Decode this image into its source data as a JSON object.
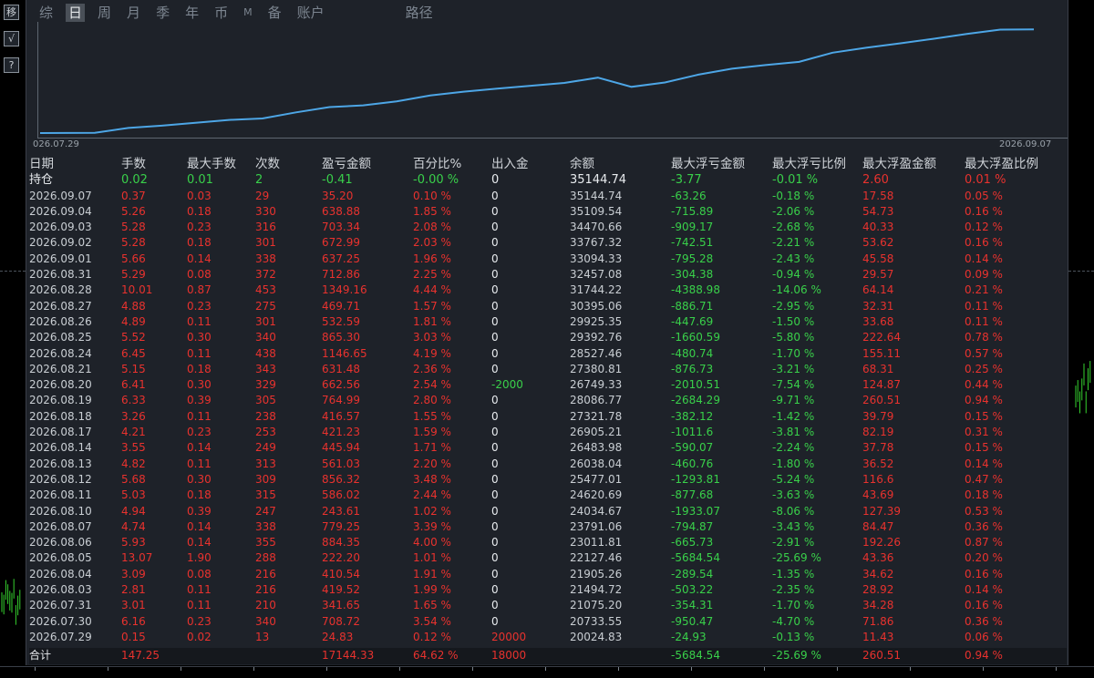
{
  "toolbar": {
    "tabs": [
      "综",
      "日",
      "周",
      "月",
      "季",
      "年",
      "币",
      "M",
      "备",
      "账户",
      "路径"
    ],
    "active_index": 1
  },
  "side_buttons": [
    "移",
    "√",
    "?"
  ],
  "equity_chart": {
    "start_label": "026.07.29",
    "end_label": "2026.09.07",
    "line_color": "#4da6e6"
  },
  "columns": [
    "日期",
    "手数",
    "最大手数",
    "次数",
    "盈亏金额",
    "百分比%",
    "出入金",
    "余额",
    "最大浮亏金额",
    "最大浮亏比例",
    "最大浮盈金额",
    "最大浮盈比例"
  ],
  "holding": [
    "持仓",
    "0.02",
    "0.01",
    "2",
    "-0.41",
    "-0.00 %",
    "0",
    "35144.74",
    "-3.77",
    "-0.01 %",
    "2.60",
    "0.01 %"
  ],
  "rows": [
    [
      "2026.09.07",
      "0.37",
      "0.03",
      "29",
      "35.20",
      "0.10 %",
      "0",
      "35144.74",
      "-63.26",
      "-0.18 %",
      "17.58",
      "0.05 %"
    ],
    [
      "2026.09.04",
      "5.26",
      "0.18",
      "330",
      "638.88",
      "1.85 %",
      "0",
      "35109.54",
      "-715.89",
      "-2.06 %",
      "54.73",
      "0.16 %"
    ],
    [
      "2026.09.03",
      "5.28",
      "0.23",
      "316",
      "703.34",
      "2.08 %",
      "0",
      "34470.66",
      "-909.17",
      "-2.68 %",
      "40.33",
      "0.12 %"
    ],
    [
      "2026.09.02",
      "5.28",
      "0.18",
      "301",
      "672.99",
      "2.03 %",
      "0",
      "33767.32",
      "-742.51",
      "-2.21 %",
      "53.62",
      "0.16 %"
    ],
    [
      "2026.09.01",
      "5.66",
      "0.14",
      "338",
      "637.25",
      "1.96 %",
      "0",
      "33094.33",
      "-795.28",
      "-2.43 %",
      "45.58",
      "0.14 %"
    ],
    [
      "2026.08.31",
      "5.29",
      "0.08",
      "372",
      "712.86",
      "2.25 %",
      "0",
      "32457.08",
      "-304.38",
      "-0.94 %",
      "29.57",
      "0.09 %"
    ],
    [
      "2026.08.28",
      "10.01",
      "0.87",
      "453",
      "1349.16",
      "4.44 %",
      "0",
      "31744.22",
      "-4388.98",
      "-14.06 %",
      "64.14",
      "0.21 %"
    ],
    [
      "2026.08.27",
      "4.88",
      "0.23",
      "275",
      "469.71",
      "1.57 %",
      "0",
      "30395.06",
      "-886.71",
      "-2.95 %",
      "32.31",
      "0.11 %"
    ],
    [
      "2026.08.26",
      "4.89",
      "0.11",
      "301",
      "532.59",
      "1.81 %",
      "0",
      "29925.35",
      "-447.69",
      "-1.50 %",
      "33.68",
      "0.11 %"
    ],
    [
      "2026.08.25",
      "5.52",
      "0.30",
      "340",
      "865.30",
      "3.03 %",
      "0",
      "29392.76",
      "-1660.59",
      "-5.80 %",
      "222.64",
      "0.78 %"
    ],
    [
      "2026.08.24",
      "6.45",
      "0.11",
      "438",
      "1146.65",
      "4.19 %",
      "0",
      "28527.46",
      "-480.74",
      "-1.70 %",
      "155.11",
      "0.57 %"
    ],
    [
      "2026.08.21",
      "5.15",
      "0.18",
      "343",
      "631.48",
      "2.36 %",
      "0",
      "27380.81",
      "-876.73",
      "-3.21 %",
      "68.31",
      "0.25 %"
    ],
    [
      "2026.08.20",
      "6.41",
      "0.30",
      "329",
      "662.56",
      "2.54 %",
      "-2000",
      "26749.33",
      "-2010.51",
      "-7.54 %",
      "124.87",
      "0.44 %"
    ],
    [
      "2026.08.19",
      "6.33",
      "0.39",
      "305",
      "764.99",
      "2.80 %",
      "0",
      "28086.77",
      "-2684.29",
      "-9.71 %",
      "260.51",
      "0.94 %"
    ],
    [
      "2026.08.18",
      "3.26",
      "0.11",
      "238",
      "416.57",
      "1.55 %",
      "0",
      "27321.78",
      "-382.12",
      "-1.42 %",
      "39.79",
      "0.15 %"
    ],
    [
      "2026.08.17",
      "4.21",
      "0.23",
      "253",
      "421.23",
      "1.59 %",
      "0",
      "26905.21",
      "-1011.6",
      "-3.81 %",
      "82.19",
      "0.31 %"
    ],
    [
      "2026.08.14",
      "3.55",
      "0.14",
      "249",
      "445.94",
      "1.71 %",
      "0",
      "26483.98",
      "-590.07",
      "-2.24 %",
      "37.78",
      "0.15 %"
    ],
    [
      "2026.08.13",
      "4.82",
      "0.11",
      "313",
      "561.03",
      "2.20 %",
      "0",
      "26038.04",
      "-460.76",
      "-1.80 %",
      "36.52",
      "0.14 %"
    ],
    [
      "2026.08.12",
      "5.68",
      "0.30",
      "309",
      "856.32",
      "3.48 %",
      "0",
      "25477.01",
      "-1293.81",
      "-5.24 %",
      "116.6",
      "0.47 %"
    ],
    [
      "2026.08.11",
      "5.03",
      "0.18",
      "315",
      "586.02",
      "2.44 %",
      "0",
      "24620.69",
      "-877.68",
      "-3.63 %",
      "43.69",
      "0.18 %"
    ],
    [
      "2026.08.10",
      "4.94",
      "0.39",
      "247",
      "243.61",
      "1.02 %",
      "0",
      "24034.67",
      "-1933.07",
      "-8.06 %",
      "127.39",
      "0.53 %"
    ],
    [
      "2026.08.07",
      "4.74",
      "0.14",
      "338",
      "779.25",
      "3.39 %",
      "0",
      "23791.06",
      "-794.87",
      "-3.43 %",
      "84.47",
      "0.36 %"
    ],
    [
      "2026.08.06",
      "5.93",
      "0.14",
      "355",
      "884.35",
      "4.00 %",
      "0",
      "23011.81",
      "-665.73",
      "-2.91 %",
      "192.26",
      "0.87 %"
    ],
    [
      "2026.08.05",
      "13.07",
      "1.90",
      "288",
      "222.20",
      "1.01 %",
      "0",
      "22127.46",
      "-5684.54",
      "-25.69 %",
      "43.36",
      "0.20 %"
    ],
    [
      "2026.08.04",
      "3.09",
      "0.08",
      "216",
      "410.54",
      "1.91 %",
      "0",
      "21905.26",
      "-289.54",
      "-1.35 %",
      "34.62",
      "0.16 %"
    ],
    [
      "2026.08.03",
      "2.81",
      "0.11",
      "216",
      "419.52",
      "1.99 %",
      "0",
      "21494.72",
      "-503.22",
      "-2.35 %",
      "28.92",
      "0.14 %"
    ],
    [
      "2026.07.31",
      "3.01",
      "0.11",
      "210",
      "341.65",
      "1.65 %",
      "0",
      "21075.20",
      "-354.31",
      "-1.70 %",
      "34.28",
      "0.16 %"
    ],
    [
      "2026.07.30",
      "6.16",
      "0.23",
      "340",
      "708.72",
      "3.54 %",
      "0",
      "20733.55",
      "-950.47",
      "-4.70 %",
      "71.86",
      "0.36 %"
    ],
    [
      "2026.07.29",
      "0.15",
      "0.02",
      "13",
      "24.83",
      "0.12 %",
      "20000",
      "20024.83",
      "-24.93",
      "-0.13 %",
      "11.43",
      "0.06 %"
    ]
  ],
  "total": [
    "合计",
    "147.25",
    "",
    "",
    "17144.33",
    "64.62 %",
    "18000",
    "",
    "-5684.54",
    "-25.69 %",
    "260.51",
    "0.94 %"
  ]
}
